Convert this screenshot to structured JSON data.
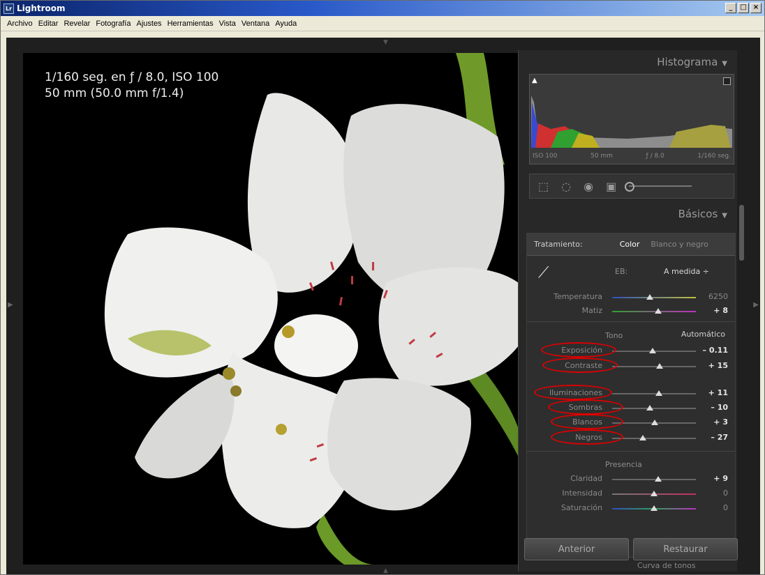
{
  "window": {
    "title": "Lightroom",
    "icon": "Lr"
  },
  "window_controls": {
    "minimize": "_",
    "maximize": "□",
    "close": "×"
  },
  "menu": [
    "Archivo",
    "Editar",
    "Revelar",
    "Fotografía",
    "Ajustes",
    "Herramientas",
    "Vista",
    "Ventana",
    "Ayuda"
  ],
  "photo": {
    "exif_line1": "1/160 seg. en ƒ / 8.0, ISO 100",
    "exif_line2": "50 mm (50.0 mm f/1.4)"
  },
  "histogram": {
    "title": "Histograma",
    "iso": "ISO 100",
    "focal": "50 mm",
    "aperture": "ƒ / 8.0",
    "shutter": "1/160 seg."
  },
  "basic": {
    "title": "Básicos",
    "treatment_label": "Tratamiento:",
    "treatment_color": "Color",
    "treatment_bw": "Blanco y negro",
    "wb_label": "EB:",
    "wb_value": "A medida ÷",
    "temperatura": {
      "label": "Temperatura",
      "value": "6250",
      "pos": 0.45
    },
    "matiz": {
      "label": "Matiz",
      "value": "+ 8",
      "pos": 0.55
    },
    "tono_label": "Tono",
    "auto_label": "Automático",
    "exposicion": {
      "label": "Exposición",
      "value": "– 0.11",
      "pos": 0.48
    },
    "contraste": {
      "label": "Contraste",
      "value": "+ 15",
      "pos": 0.57
    },
    "iluminaciones": {
      "label": "Iluminaciones",
      "value": "+ 11",
      "pos": 0.56
    },
    "sombras": {
      "label": "Sombras",
      "value": "– 10",
      "pos": 0.45
    },
    "blancos": {
      "label": "Blancos",
      "value": "+ 3",
      "pos": 0.51
    },
    "negros": {
      "label": "Negros",
      "value": "– 27",
      "pos": 0.37
    },
    "presencia_label": "Presencia",
    "claridad": {
      "label": "Claridad",
      "value": "+ 9",
      "pos": 0.55
    },
    "intensidad": {
      "label": "Intensidad",
      "value": "0",
      "pos": 0.5
    },
    "saturacion": {
      "label": "Saturación",
      "value": "0",
      "pos": 0.5
    }
  },
  "curvas_label": "Curva de tonos",
  "buttons": {
    "anterior": "Anterior",
    "restaurar": "Restaurar"
  },
  "colors": {
    "panel_bg": "#282828",
    "highlight_oval": "#dd0000",
    "photo_bg": "#000000"
  }
}
